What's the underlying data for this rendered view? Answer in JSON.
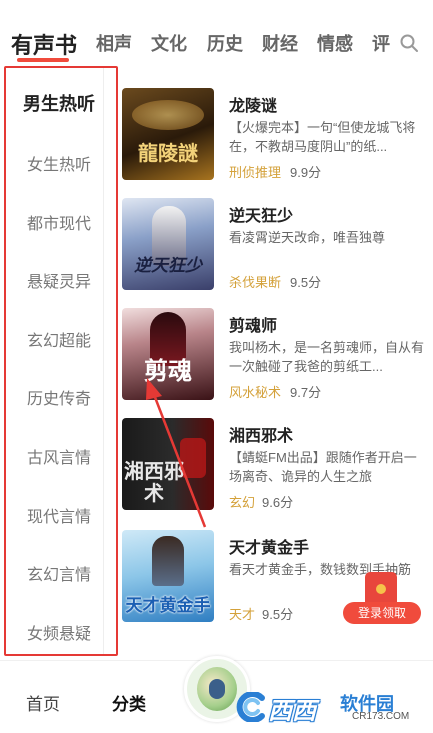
{
  "tabs": [
    {
      "label": "有声书",
      "active": true
    },
    {
      "label": "相声"
    },
    {
      "label": "文化"
    },
    {
      "label": "历史"
    },
    {
      "label": "财经"
    },
    {
      "label": "情感"
    },
    {
      "label": "评"
    }
  ],
  "sidebar": {
    "items": [
      {
        "label": "男生热听",
        "active": true
      },
      {
        "label": "女生热听"
      },
      {
        "label": "都市现代"
      },
      {
        "label": "悬疑灵异"
      },
      {
        "label": "玄幻超能"
      },
      {
        "label": "历史传奇"
      },
      {
        "label": "古风言情"
      },
      {
        "label": "现代言情"
      },
      {
        "label": "玄幻言情"
      },
      {
        "label": "女频悬疑"
      }
    ]
  },
  "books": [
    {
      "title": "龙陵谜",
      "desc": "【火爆完本】一句“但使龙城飞将在，不教胡马度阴山”的纸...",
      "tag": "刑侦推理",
      "score": "9.9分",
      "cover_text": "龍陵謎"
    },
    {
      "title": "逆天狂少",
      "desc": "看凌霄逆天改命，唯吾独尊",
      "tag": "杀伐果断",
      "score": "9.5分",
      "cover_text": "逆天狂少"
    },
    {
      "title": "剪魂师",
      "desc": "我叫杨木，是一名剪魂师，自从有一次触碰了我爸的剪纸工...",
      "tag": "风水秘术",
      "score": "9.7分",
      "cover_text": "剪魂"
    },
    {
      "title": "湘西邪术",
      "desc": "【蜻蜓FM出品】跟随作者开启一场离奇、诡异的人生之旅",
      "tag": "玄幻",
      "score": "9.6分",
      "cover_text": "湘西邪术"
    },
    {
      "title": "天才黄金手",
      "desc": "看天才黄金手，数钱数到手抽筋",
      "tag": "天才",
      "score": "9.5分",
      "cover_text": "天才黄金手"
    }
  ],
  "promo": {
    "label": "登录领取"
  },
  "bottom_nav": {
    "home": "首页",
    "category": "分类"
  },
  "watermark": {
    "text1": "西西",
    "text2": "软件园",
    "text3": "CR173.COM"
  },
  "colors": {
    "accent": "#f04b3c",
    "tag": "#d4a13a",
    "highlight_box": "#e53935"
  }
}
